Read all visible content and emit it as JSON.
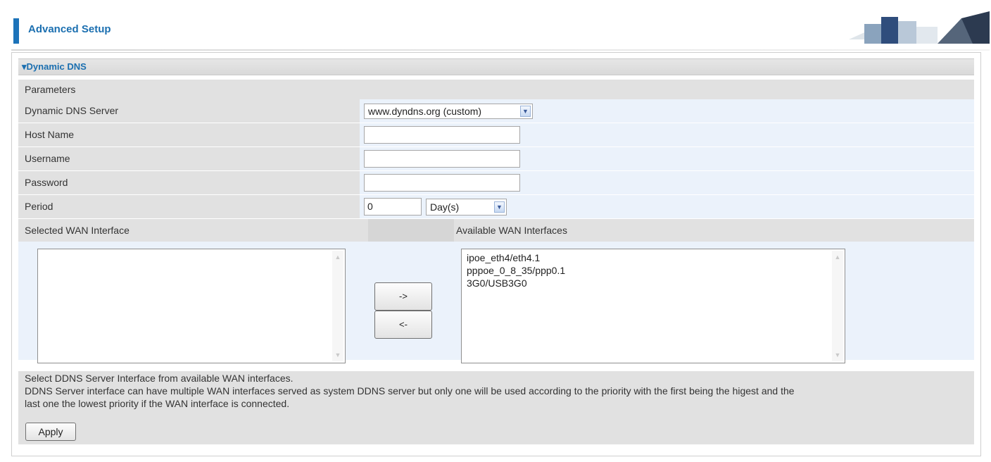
{
  "header": {
    "title": "Advanced Setup"
  },
  "section": {
    "title": "Dynamic DNS"
  },
  "parameters": {
    "label": "Parameters"
  },
  "fields": {
    "server": {
      "label": "Dynamic DNS Server",
      "value": "www.dyndns.org (custom)"
    },
    "host_name": {
      "label": "Host Name",
      "value": ""
    },
    "username": {
      "label": "Username",
      "value": ""
    },
    "password": {
      "label": "Password",
      "value": ""
    },
    "period": {
      "label": "Period",
      "value": "0",
      "unit": "Day(s)"
    }
  },
  "wan": {
    "selected_label": "Selected WAN Interface",
    "available_label": "Available WAN Interfaces",
    "available": [
      "ipoe_eth4/eth4.1",
      "pppoe_0_8_35/ppp0.1",
      "3G0/USB3G0"
    ],
    "move_right_label": "->",
    "move_left_label": "<-"
  },
  "note": {
    "line1": "Select DDNS Server Interface from available WAN interfaces.",
    "line2": "DDNS Server interface can have multiple WAN interfaces served as system DDNS server but only one will be used according to the priority with the first being the higest and the",
    "line3": "last one the lowest priority if the WAN interface is connected."
  },
  "apply_label": "Apply",
  "colors": {
    "accent": "#1c73b9",
    "title": "#1b6fb0",
    "row_gray": "#e1e1e1",
    "row_blue": "#ebf2fb"
  }
}
